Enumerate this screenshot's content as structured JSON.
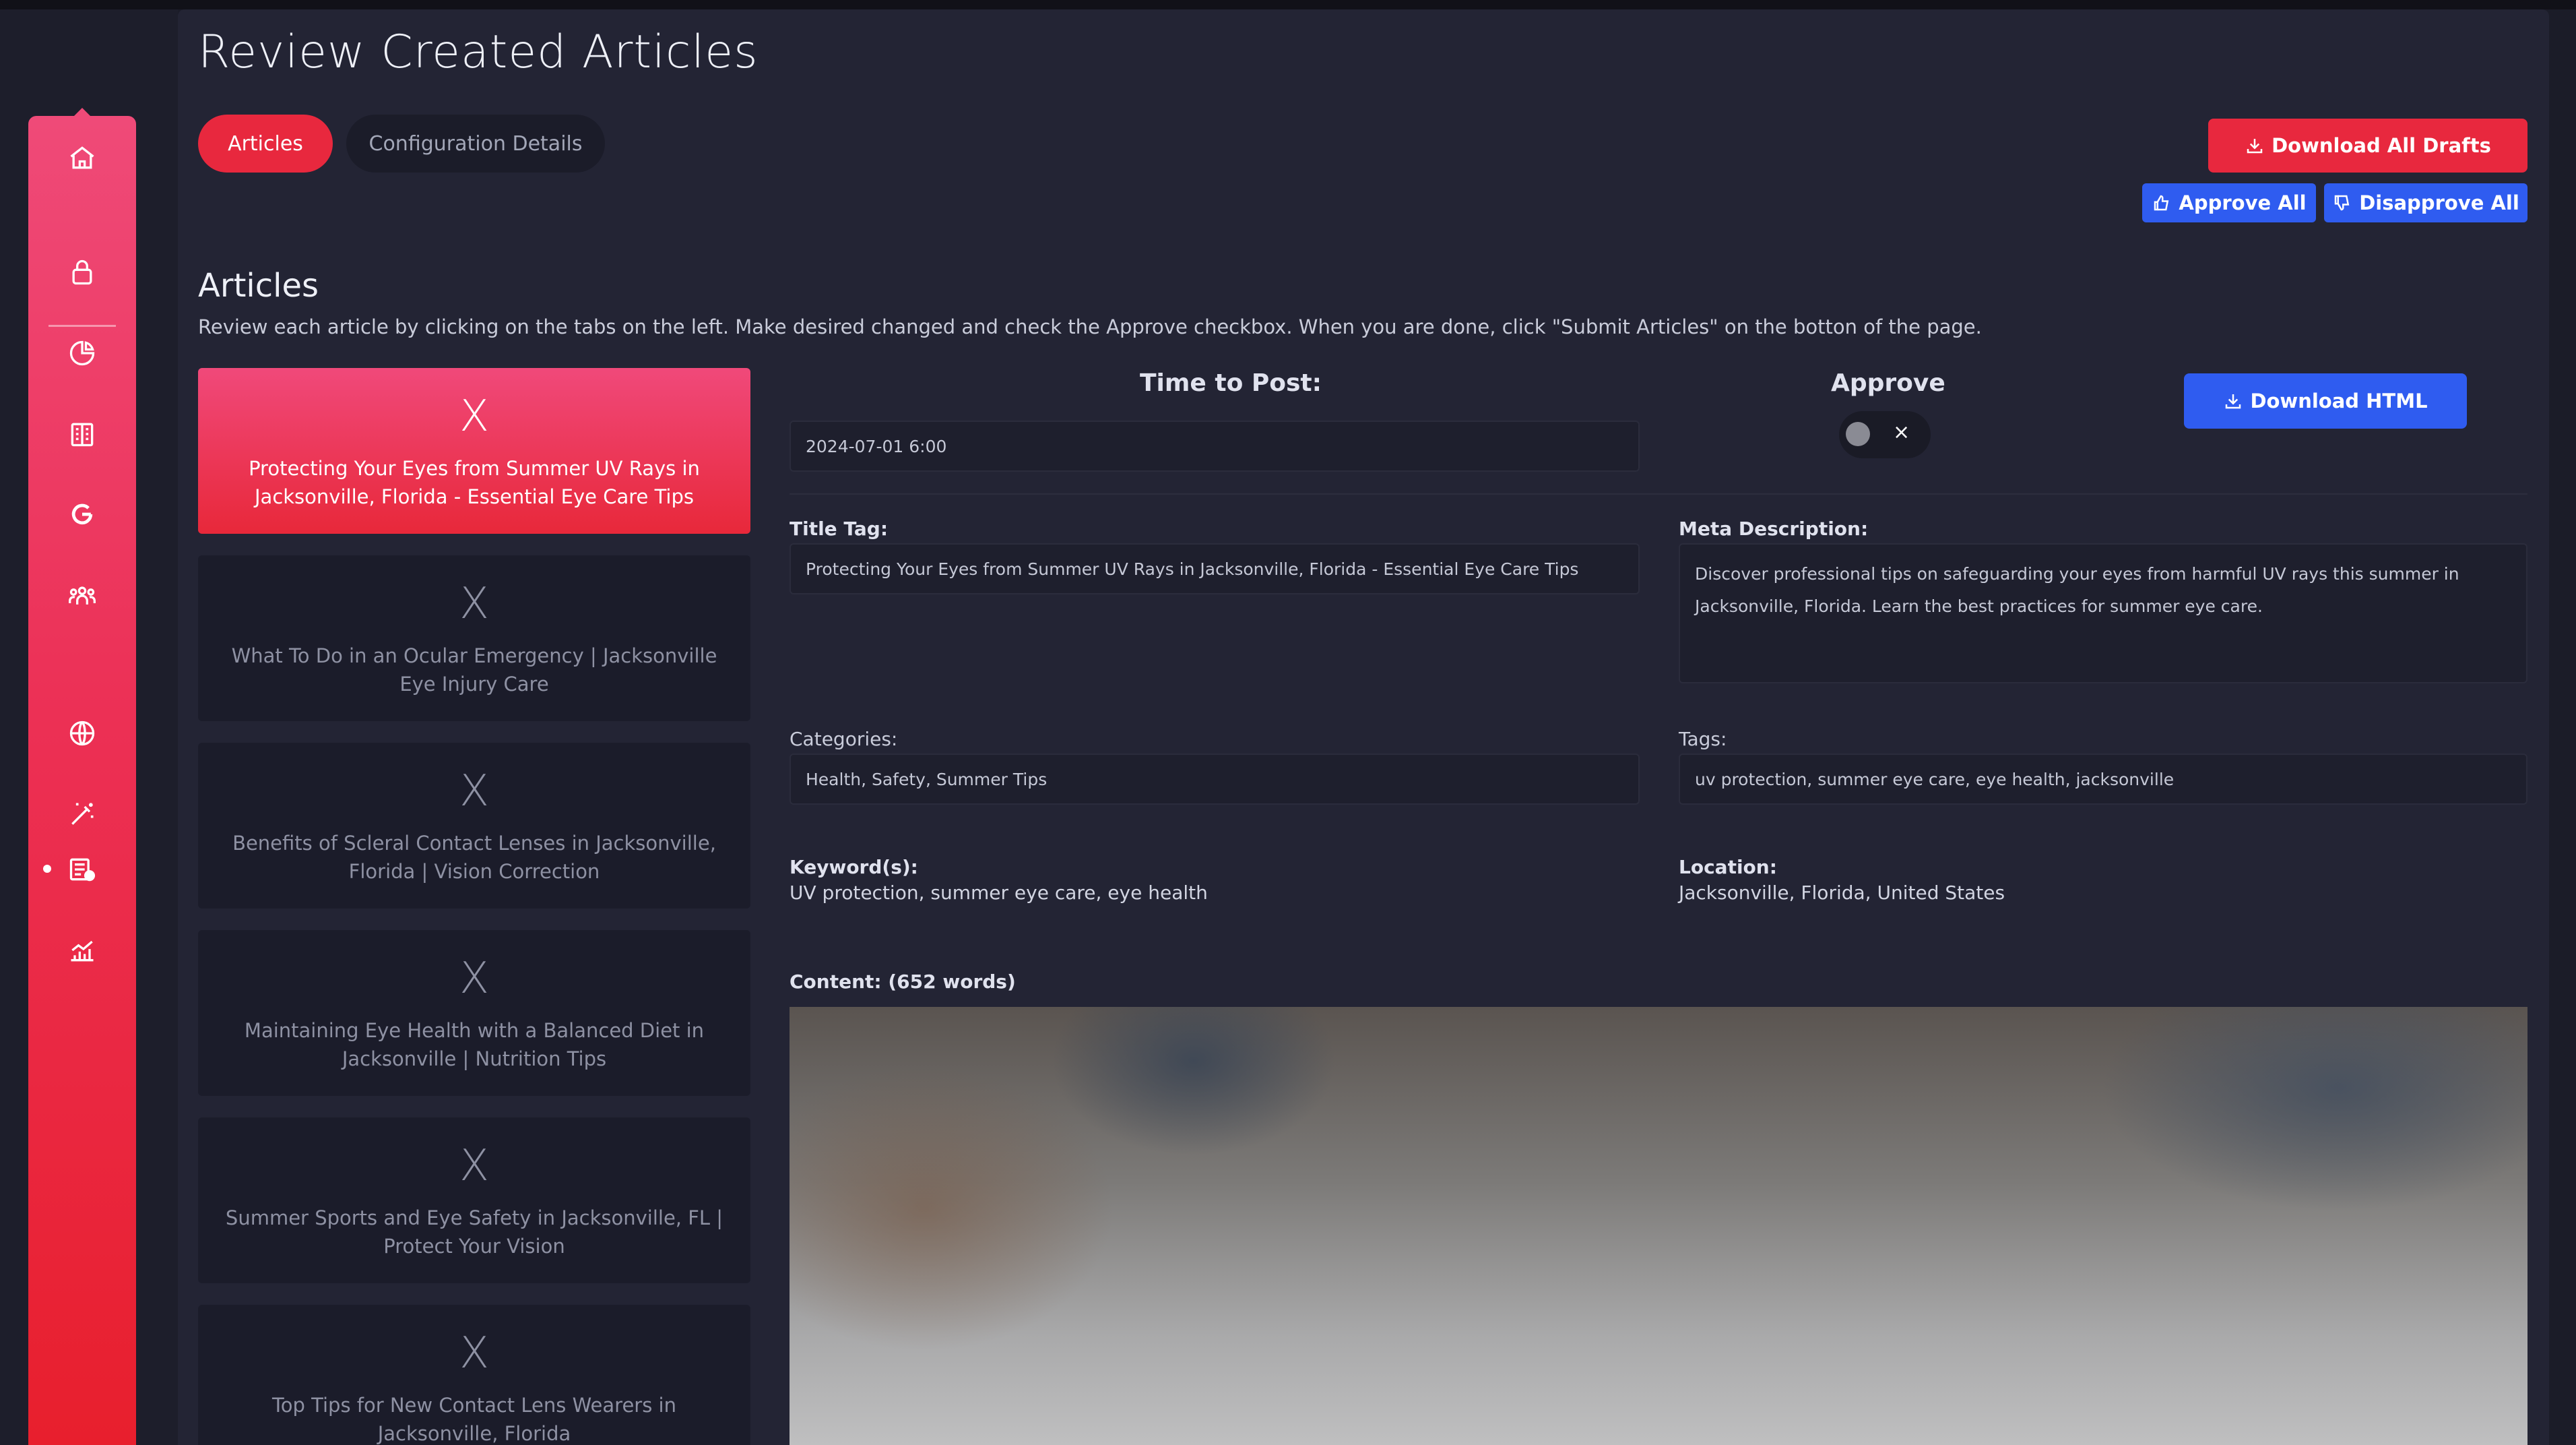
{
  "page": {
    "title": "Review Created Articles"
  },
  "tabs": {
    "articles": "Articles",
    "config": "Configuration Details"
  },
  "actions": {
    "download_all": "Download All Drafts",
    "approve_all": "Approve All",
    "disapprove_all": "Disapprove All",
    "download_html": "Download HTML"
  },
  "section": {
    "title": "Articles",
    "description": "Review each article by clicking on the tabs on the left. Make desired changed and check the Approve checkbox. When you are done, click \"Submit Articles\" on the botton of the page."
  },
  "sidebar": {
    "icons": [
      "home-icon",
      "lock-icon",
      "pie-chart-icon",
      "building-icon",
      "google-icon",
      "team-icon",
      "globe-icon",
      "magic-wand-icon",
      "articles-icon",
      "analytics-icon"
    ],
    "active": "articles-icon"
  },
  "articles": [
    {
      "close": "X",
      "title": "Protecting Your Eyes from Summer UV Rays in Jacksonville, Florida - Essential Eye Care Tips"
    },
    {
      "close": "X",
      "title": "What To Do in an Ocular Emergency | Jacksonville Eye Injury Care"
    },
    {
      "close": "X",
      "title": "Benefits of Scleral Contact Lenses in Jacksonville, Florida | Vision Correction"
    },
    {
      "close": "X",
      "title": "Maintaining Eye Health with a Balanced Diet in Jacksonville | Nutrition Tips"
    },
    {
      "close": "X",
      "title": "Summer Sports and Eye Safety in Jacksonville, FL | Protect Your Vision"
    },
    {
      "close": "X",
      "title": "Top Tips for New Contact Lens Wearers in Jacksonville, Florida"
    }
  ],
  "detail": {
    "time_label": "Time to Post:",
    "time_value": "2024-07-01 6:00",
    "approve_label": "Approve",
    "approve_toggle_symbol": "×",
    "title_tag_label": "Title Tag:",
    "title_tag_value": "Protecting Your Eyes from Summer UV Rays in Jacksonville, Florida - Essential Eye Care Tips",
    "meta_label": "Meta Description:",
    "meta_value": "Discover professional tips on safeguarding your eyes from harmful UV rays this summer in Jacksonville, Florida. Learn the best practices for summer eye care.",
    "categories_label": "Categories:",
    "categories_value": "Health, Safety, Summer Tips",
    "tags_label": "Tags:",
    "tags_value": "uv protection, summer eye care, eye health, jacksonville",
    "keywords_label": "Keyword(s):",
    "keywords_value": "UV protection, summer eye care, eye health",
    "location_label": "Location:",
    "location_value": "Jacksonville, Florida, United States",
    "content_label": "Content: (652 words)"
  },
  "colors": {
    "accent_red": "#e8283e",
    "accent_blue": "#2f5cf0",
    "panel": "#232434"
  }
}
